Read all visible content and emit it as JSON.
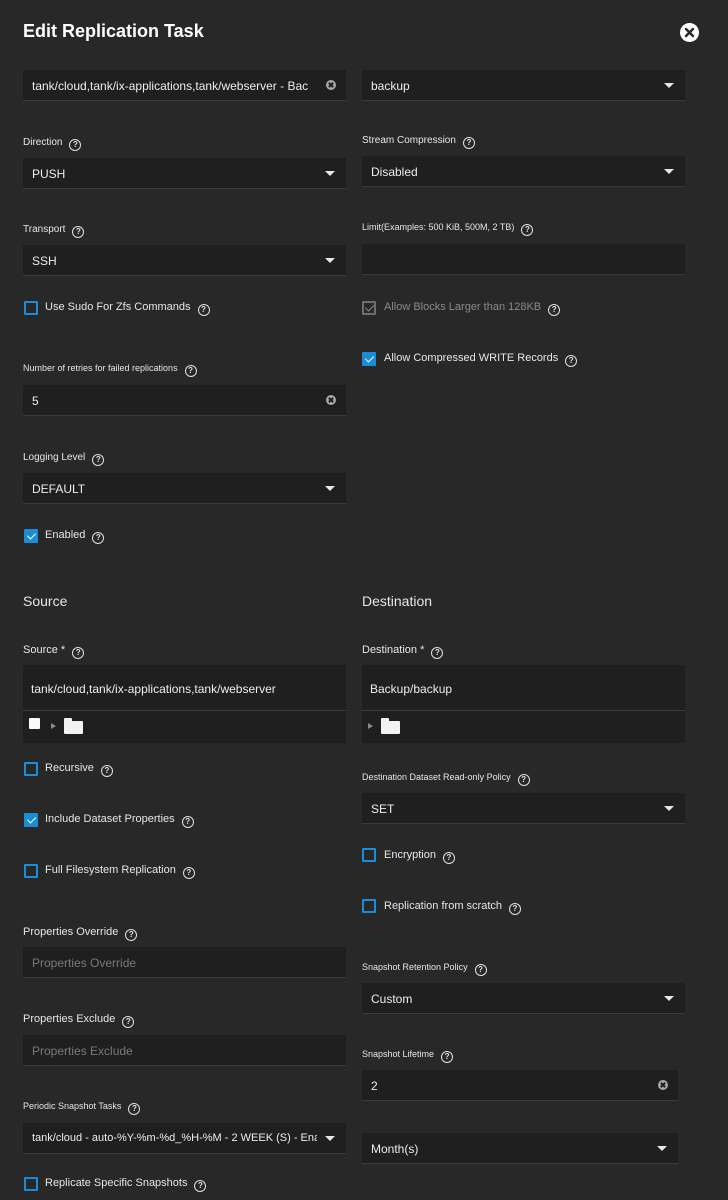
{
  "dialog": {
    "title": "Edit Replication Task"
  },
  "top": {
    "snapshot_sources_value": "tank/cloud,tank/ix-applications,tank/webserver - Bac",
    "target_value": "backup"
  },
  "direction": {
    "label": "Direction",
    "value": "PUSH"
  },
  "stream_compression": {
    "label": "Stream Compression",
    "value": "Disabled"
  },
  "transport": {
    "label": "Transport",
    "value": "SSH"
  },
  "limit": {
    "label": "Limit(Examples: 500 KiB, 500M, 2 TB)",
    "value": ""
  },
  "use_sudo": {
    "label": "Use Sudo For Zfs Commands",
    "checked": false
  },
  "allow_blocks": {
    "label": "Allow Blocks Larger than 128KB",
    "checked": true,
    "disabled": true
  },
  "allow_compressed": {
    "label": "Allow Compressed WRITE Records",
    "checked": true
  },
  "retries": {
    "label": "Number of retries for failed replications",
    "value": "5"
  },
  "logging": {
    "label": "Logging Level",
    "value": "DEFAULT"
  },
  "enabled": {
    "label": "Enabled",
    "checked": true
  },
  "source_section": {
    "title": "Source"
  },
  "destination_section": {
    "title": "Destination"
  },
  "source": {
    "label": "Source *",
    "value": "tank/cloud,tank/ix-applications,tank/webserver"
  },
  "destination": {
    "label": "Destination *",
    "value": "Backup/backup"
  },
  "recursive": {
    "label": "Recursive",
    "checked": false
  },
  "include_props": {
    "label": "Include Dataset Properties",
    "checked": true
  },
  "full_fs": {
    "label": "Full Filesystem Replication",
    "checked": false
  },
  "dest_readonly": {
    "label": "Destination Dataset Read-only Policy",
    "value": "SET"
  },
  "encryption": {
    "label": "Encryption",
    "checked": false
  },
  "from_scratch": {
    "label": "Replication from scratch",
    "checked": false
  },
  "props_override": {
    "label": "Properties Override",
    "placeholder": "Properties Override"
  },
  "props_exclude": {
    "label": "Properties Exclude",
    "placeholder": "Properties Exclude"
  },
  "retention": {
    "label": "Snapshot Retention Policy",
    "value": "Custom"
  },
  "lifetime": {
    "label": "Snapshot Lifetime",
    "value": "2",
    "unit": "Month(s)"
  },
  "periodic": {
    "label": "Periodic Snapshot Tasks",
    "value": "tank/cloud - auto-%Y-%m-%d_%H-%M - 2 WEEK (S) - Ena..."
  },
  "replicate_specific": {
    "label": "Replicate Specific Snapshots",
    "checked": false
  },
  "icons": {
    "help": "?",
    "close": "close-icon",
    "folder": "folder-icon"
  },
  "colors": {
    "background": "#282828",
    "field": "#1f1f1f",
    "accent": "#1a8cd8"
  }
}
